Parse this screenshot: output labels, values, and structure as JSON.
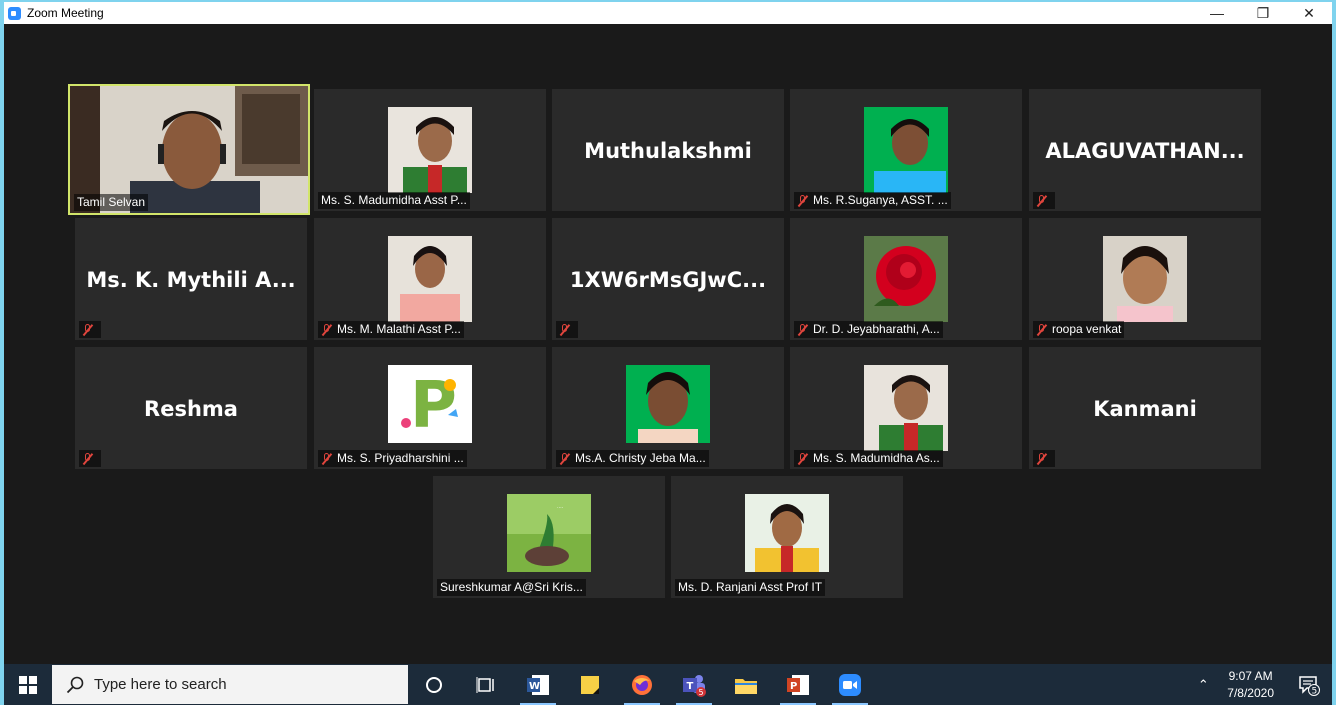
{
  "window": {
    "title": "Zoom Meeting",
    "controls": {
      "minimize": "—",
      "restore": "❐",
      "close": "✕"
    }
  },
  "participants": [
    {
      "name": "Tamil Selvan",
      "label": "Tamil Selvan",
      "muted": false,
      "active": true,
      "has_video": true
    },
    {
      "label": "Ms. S. Madumidha Asst P...",
      "muted": false,
      "has_photo": true
    },
    {
      "big": "Muthulakshmi",
      "label": "",
      "muted": false
    },
    {
      "label": "Ms. R.Suganya, ASST. ...",
      "muted": true,
      "has_photo": true
    },
    {
      "big": "ALAGUVATHAN...",
      "label": "",
      "muted": true
    },
    {
      "big": "Ms. K. Mythili A...",
      "label": "",
      "muted": true
    },
    {
      "label": "Ms. M. Malathi Asst P...",
      "muted": true,
      "has_photo": true
    },
    {
      "big": "1XW6rMsGJwC...",
      "label": "",
      "muted": true
    },
    {
      "label": "Dr. D. Jeyabharathi, A...",
      "muted": true,
      "has_photo": true
    },
    {
      "label": "roopa venkat",
      "muted": true,
      "has_photo": true
    },
    {
      "big": "Reshma",
      "label": "",
      "muted": true
    },
    {
      "label": "Ms. S. Priyadharshini ...",
      "muted": true,
      "has_photo": true
    },
    {
      "label": "Ms.A. Christy Jeba Ma...",
      "muted": true,
      "has_photo": true
    },
    {
      "label": "Ms. S. Madumidha As...",
      "muted": true,
      "has_photo": true
    },
    {
      "big": "Kanmani",
      "label": "",
      "muted": true
    },
    {
      "label": "Sureshkumar A@Sri Kris...",
      "muted": false,
      "has_photo": true
    },
    {
      "label": "Ms. D. Ranjani Asst Prof IT",
      "muted": false,
      "has_photo": true
    }
  ],
  "taskbar": {
    "search_placeholder": "Type here to search",
    "teams_badge": "5",
    "time": "9:07 AM",
    "date": "7/8/2020",
    "notification_count": "5"
  },
  "colors": {
    "active_speaker_border": "#d2e56a",
    "tile_bg": "#2a2a2a",
    "muted_icon": "#e0453d"
  }
}
